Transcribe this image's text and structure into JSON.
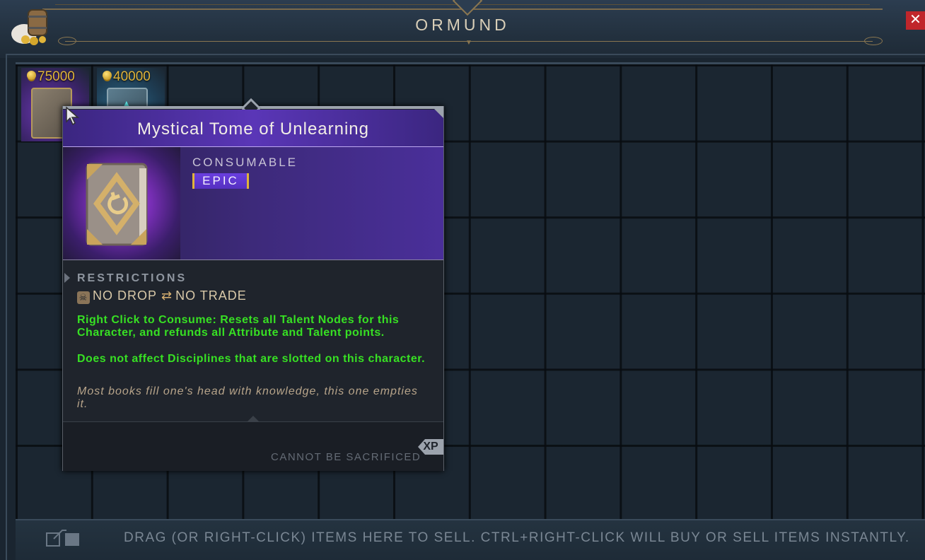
{
  "vendor": {
    "title": "ORMUND",
    "close_symbol": "✕"
  },
  "items": [
    {
      "price": "75000",
      "name": "Mystical Tome of Unlearning",
      "accent": "#6b38b3"
    },
    {
      "price": "40000",
      "accent": "#2e6a8a"
    }
  ],
  "tooltip": {
    "name": "Mystical Tome of Unlearning",
    "type": "CONSUMABLE",
    "rarity": "EPIC",
    "rarity_color": "#5a36b7",
    "restrictions_title": "RESTRICTIONS",
    "restriction_no_drop": "NO DROP",
    "restriction_no_trade": "NO TRADE",
    "effect_1": "Right Click to Consume: Resets all Talent Nodes for this Character, and refunds all Attribute and Talent points.",
    "effect_2": "Does not affect Disciplines that are slotted on this character.",
    "flavor": "Most books fill one's head with knowledge, this one empties it.",
    "xp_badge": "XP",
    "sacrifice_note": "CANNOT BE SACRIFICED"
  },
  "sell_bar": {
    "hint": "DRAG (OR RIGHT-CLICK) ITEMS HERE TO SELL. CTRL+RIGHT-CLICK WILL BUY OR SELL ITEMS INSTANTLY."
  },
  "colors": {
    "effect_text": "#37e023",
    "price_text": "#e0b43a",
    "close_button": "#c0262b"
  }
}
